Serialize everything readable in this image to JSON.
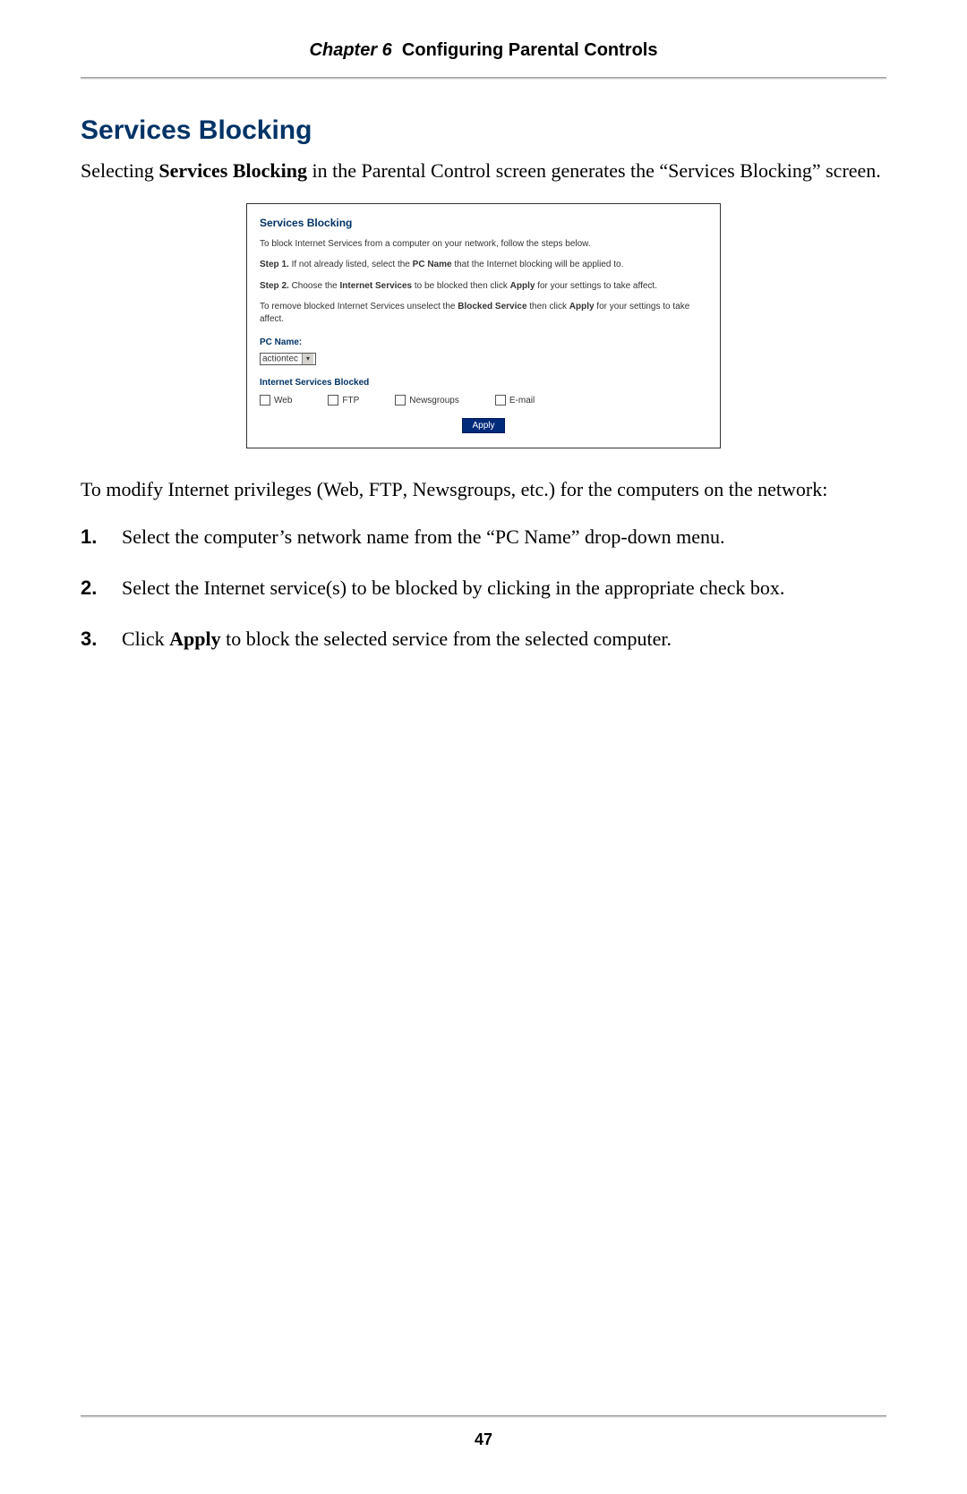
{
  "header": {
    "chapter_label": "Chapter 6",
    "chapter_title": "Configuring Parental Controls"
  },
  "section": {
    "heading": "Services Blocking",
    "intro_pre": "Selecting ",
    "intro_bold": "Services Blocking",
    "intro_post": " in the Parental Control screen generates the “Services Blocking” screen."
  },
  "panel": {
    "title": "Services Blocking",
    "line1": "To block Internet Services from a computer on your network, follow the steps below.",
    "step1_pre": "Step 1.",
    "step1_mid1": " If not already listed, select the ",
    "step1_bold1": "PC Name",
    "step1_post1": " that the Internet blocking will be applied to.",
    "step2_pre": "Step 2.",
    "step2_mid1": " Choose the ",
    "step2_bold1": "Internet Services",
    "step2_mid2": " to be blocked then click ",
    "step2_bold2": "Apply",
    "step2_post": " for your settings to take affect.",
    "remove_pre": "To remove blocked Internet Services unselect the ",
    "remove_bold1": "Blocked Service",
    "remove_mid": " then click ",
    "remove_bold2": "Apply",
    "remove_post": " for your settings to take affect.",
    "pc_name_label": "PC Name:",
    "pc_name_value": "actiontec",
    "services_label": "Internet Services Blocked",
    "services": {
      "web": "Web",
      "ftp": "FTP",
      "newsgroups": "Newsgroups",
      "email": "E-mail"
    },
    "apply_label": "Apply"
  },
  "post_figure": {
    "text_pre": "To modify Internet privileges (Web, ",
    "ftp_sc": "FTP",
    "text_post": ", Newsgroups, etc.) for the computers on the network:"
  },
  "steps": [
    {
      "num": "1.",
      "text": "Select the computer’s network name from the “PC Name” drop-down menu."
    },
    {
      "num": "2.",
      "text": "Select the Internet service(s) to be blocked by clicking in the appropriate check box."
    },
    {
      "num": "3.",
      "text_pre": "Click ",
      "bold": "Apply",
      "text_post": " to block the selected service from the selected computer."
    }
  ],
  "page_number": "47"
}
